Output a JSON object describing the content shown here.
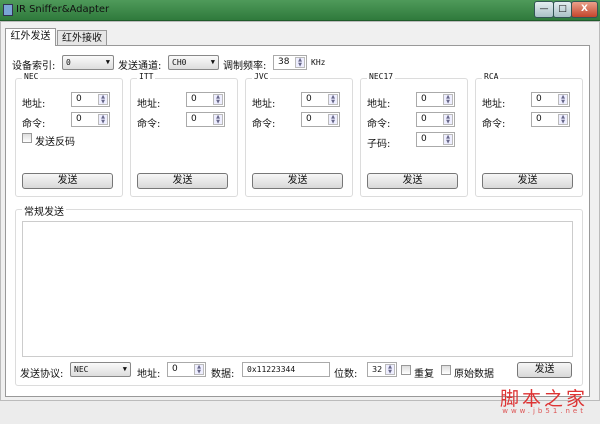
{
  "window": {
    "title": "IR Sniffer&Adapter",
    "minimize": "—",
    "maximize": "□",
    "close": "X"
  },
  "tabs": [
    {
      "label": "红外发送",
      "active": true
    },
    {
      "label": "红外接收",
      "active": false
    }
  ],
  "settings": {
    "device_label": "设备索引:",
    "device_value": "0",
    "channel_label": "发送通道:",
    "channel_value": "CH0",
    "freq_label": "调制频率:",
    "freq_value": "38",
    "freq_unit": "KHz"
  },
  "groups": [
    {
      "title": "NEC",
      "addr_label": "地址:",
      "addr": "0",
      "cmd_label": "命令:",
      "cmd": "0",
      "checkbox_label": "发送反码",
      "send": "发送"
    },
    {
      "title": "ITT",
      "addr_label": "地址:",
      "addr": "0",
      "cmd_label": "命令:",
      "cmd": "0",
      "send": "发送"
    },
    {
      "title": "JVC",
      "addr_label": "地址:",
      "addr": "0",
      "cmd_label": "命令:",
      "cmd": "0",
      "send": "发送"
    },
    {
      "title": "NEC17",
      "addr_label": "地址:",
      "addr": "0",
      "cmd_label": "命令:",
      "cmd": "0",
      "sub_label": "子码:",
      "sub": "0",
      "send": "发送"
    },
    {
      "title": "RCA",
      "addr_label": "地址:",
      "addr": "0",
      "cmd_label": "命令:",
      "cmd": "0",
      "send": "发送"
    }
  ],
  "general": {
    "title": "常规发送",
    "protocol_label": "发送协议:",
    "protocol": "NEC",
    "addr_label": "地址:",
    "addr": "0",
    "data_label": "数据:",
    "data": "0x11223344",
    "bits_label": "位数:",
    "bits": "32",
    "repeat_label": "重复",
    "raw_label": "原始数据",
    "send": "发送"
  },
  "watermark": {
    "text": "脚本之家",
    "url": "www.jb51.net"
  }
}
